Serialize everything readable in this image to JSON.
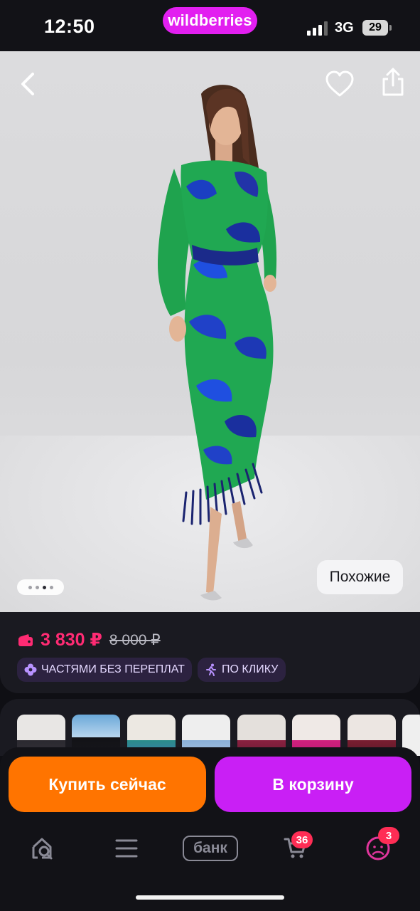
{
  "status_bar": {
    "time": "12:50",
    "brand": "wildberries",
    "network": "3G",
    "battery": "29"
  },
  "hero": {
    "photo_alt": "product-photo",
    "pager": {
      "count": 4,
      "active_index": 2
    },
    "similar_label": "Похожие"
  },
  "price": {
    "current": "3 830 ₽",
    "old": "8 000 ₽",
    "current_color": "#ff2b73"
  },
  "promos": [
    {
      "label": "ЧАСТЯМИ БЕЗ ПЕРЕПЛАТ",
      "icon": "clover-icon"
    },
    {
      "label": "ПО КЛИКУ",
      "icon": "running-man-icon"
    }
  ],
  "actions": {
    "buy_now": "Купить сейчас",
    "to_cart": "В корзину",
    "buy_now_color": "#ff7400",
    "to_cart_color": "#c91ff5"
  },
  "nav": {
    "items": [
      {
        "name": "home-search",
        "icon": "home-search-icon"
      },
      {
        "name": "catalog",
        "icon": "menu-icon"
      },
      {
        "name": "bank",
        "label": "банк"
      },
      {
        "name": "cart",
        "icon": "cart-icon",
        "badge": "36"
      },
      {
        "name": "profile",
        "icon": "profile-icon",
        "badge": "3"
      }
    ]
  }
}
